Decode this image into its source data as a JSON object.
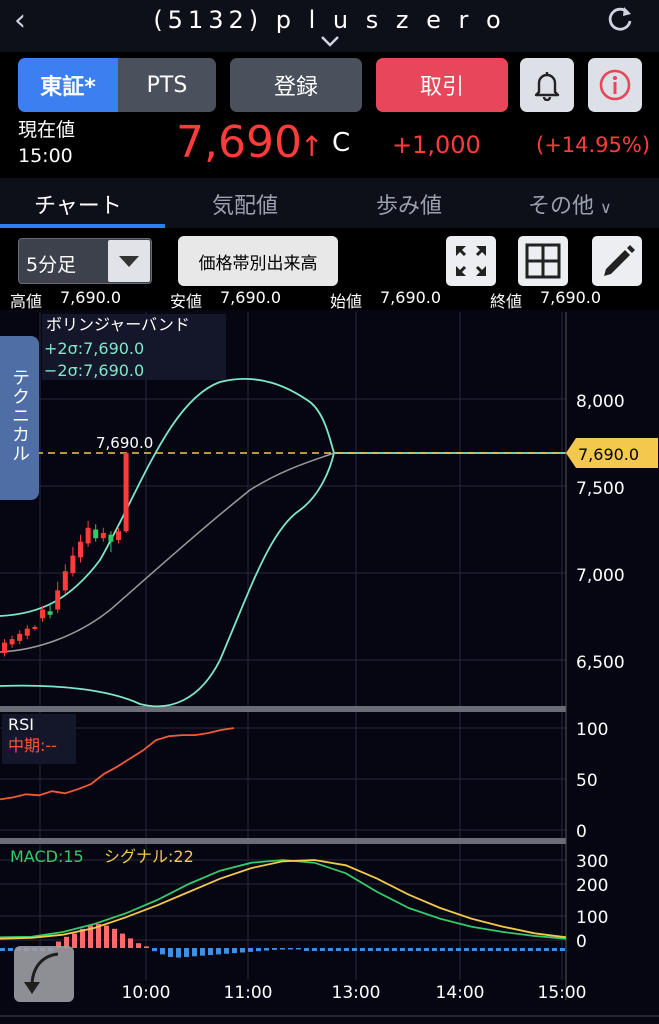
{
  "header": {
    "title": "(5132) p l u s z e r o"
  },
  "buttons": {
    "tse": "東証*",
    "pts": "PTS",
    "register": "登録",
    "trade": "取引"
  },
  "quote": {
    "label": "現在値",
    "time": "15:00",
    "price": "7,690",
    "arrow": "↑",
    "flag": "C",
    "change": "+1,000",
    "change_pct": "(+14.95%)"
  },
  "tabs": [
    {
      "label": "チャート",
      "active": true
    },
    {
      "label": "気配値",
      "active": false
    },
    {
      "label": "歩み値",
      "active": false
    },
    {
      "label": "その他",
      "active": false
    }
  ],
  "toolbar": {
    "interval": "5分足",
    "volume_by_price": "価格帯別出来高"
  },
  "ohlc": {
    "high_label": "高値",
    "high": "7,690.0",
    "low_label": "安値",
    "low": "7,690.0",
    "open_label": "始値",
    "open": "7,690.0",
    "close_label": "終値",
    "close": "7,690.0"
  },
  "technical_tab": "テクニカル",
  "colors": {
    "accent": "#3b7ff1",
    "up": "#ff3b3b",
    "bollinger": "#7ee8c8",
    "sma": "#9a9a9a",
    "rsi": "#f05a3a",
    "macd": "#36c96a",
    "signal": "#f2c94c",
    "last_price": "#f2c94c"
  },
  "chart_data": [
    {
      "type": "line",
      "title": "ボリンジャーバンド",
      "legend": [
        "+2σ:7,690.0",
        "−2σ:7,690.0"
      ],
      "last_price_label": "7,690.0",
      "high_annotation": "7,690.0",
      "yticks": [
        "8,000",
        "7,500",
        "7,000",
        "6,500"
      ],
      "ylim": [
        6150,
        8300
      ],
      "xticks": [
        "10:00",
        "11:00",
        "13:00",
        "14:00",
        "15:00"
      ],
      "last_price": 7690,
      "candles": [
        {
          "t": 0,
          "o": 6540,
          "c": 6600,
          "h": 6620,
          "l": 6520
        },
        {
          "t": 1,
          "o": 6590,
          "c": 6620,
          "h": 6640,
          "l": 6570
        },
        {
          "t": 2,
          "o": 6610,
          "c": 6650,
          "h": 6670,
          "l": 6590
        },
        {
          "t": 3,
          "o": 6640,
          "c": 6680,
          "h": 6700,
          "l": 6620
        },
        {
          "t": 4,
          "o": 6680,
          "c": 6690,
          "h": 6700,
          "l": 6670
        },
        {
          "t": 5,
          "o": 6740,
          "c": 6790,
          "h": 6810,
          "l": 6720
        },
        {
          "t": 6,
          "o": 6780,
          "c": 6760,
          "h": 6820,
          "l": 6740
        },
        {
          "t": 7,
          "o": 6790,
          "c": 6900,
          "h": 6950,
          "l": 6770
        },
        {
          "t": 8,
          "o": 6900,
          "c": 7010,
          "h": 7050,
          "l": 6880
        },
        {
          "t": 9,
          "o": 7000,
          "c": 7100,
          "h": 7150,
          "l": 6980
        },
        {
          "t": 10,
          "o": 7090,
          "c": 7180,
          "h": 7220,
          "l": 7060
        },
        {
          "t": 11,
          "o": 7170,
          "c": 7260,
          "h": 7300,
          "l": 7150
        },
        {
          "t": 12,
          "o": 7250,
          "c": 7200,
          "h": 7280,
          "l": 7180
        },
        {
          "t": 13,
          "o": 7200,
          "c": 7230,
          "h": 7260,
          "l": 7180
        },
        {
          "t": 14,
          "o": 7220,
          "c": 7180,
          "h": 7240,
          "l": 7120
        },
        {
          "t": 15,
          "o": 7190,
          "c": 7240,
          "h": 7260,
          "l": 7170
        },
        {
          "t": 16,
          "o": 7240,
          "c": 7690,
          "h": 7690,
          "l": 7230
        }
      ]
    },
    {
      "type": "line",
      "title": "RSI",
      "legend": [
        "中期:--"
      ],
      "yticks": [
        "100",
        "50",
        "0"
      ],
      "ylim": [
        0,
        100
      ],
      "values": [
        30,
        32,
        35,
        34,
        38,
        36,
        40,
        45,
        55,
        62,
        70,
        78,
        88,
        92,
        93,
        93,
        95,
        98,
        100
      ]
    },
    {
      "type": "bar",
      "title": "MACD:15",
      "legend": [
        "MACD:15",
        "シグナル:22"
      ],
      "yticks": [
        "300",
        "200",
        "100",
        "0"
      ],
      "ylim": [
        -60,
        320
      ],
      "macd": [
        10,
        12,
        30,
        60,
        100,
        150,
        210,
        260,
        290,
        300,
        290,
        250,
        180,
        120,
        80,
        50,
        30,
        15,
        5
      ],
      "signal": [
        5,
        8,
        20,
        45,
        85,
        130,
        180,
        230,
        270,
        295,
        300,
        280,
        230,
        170,
        120,
        80,
        50,
        25,
        10
      ],
      "hist": [
        20,
        35,
        45,
        60,
        70,
        75,
        70,
        60,
        45,
        30,
        15,
        5,
        -10,
        -20,
        -28,
        -30,
        -28,
        -26,
        -24,
        -22,
        -20,
        -18,
        -16,
        -14,
        -12,
        -10,
        -8,
        -6,
        -5,
        -4,
        -3
      ]
    }
  ]
}
